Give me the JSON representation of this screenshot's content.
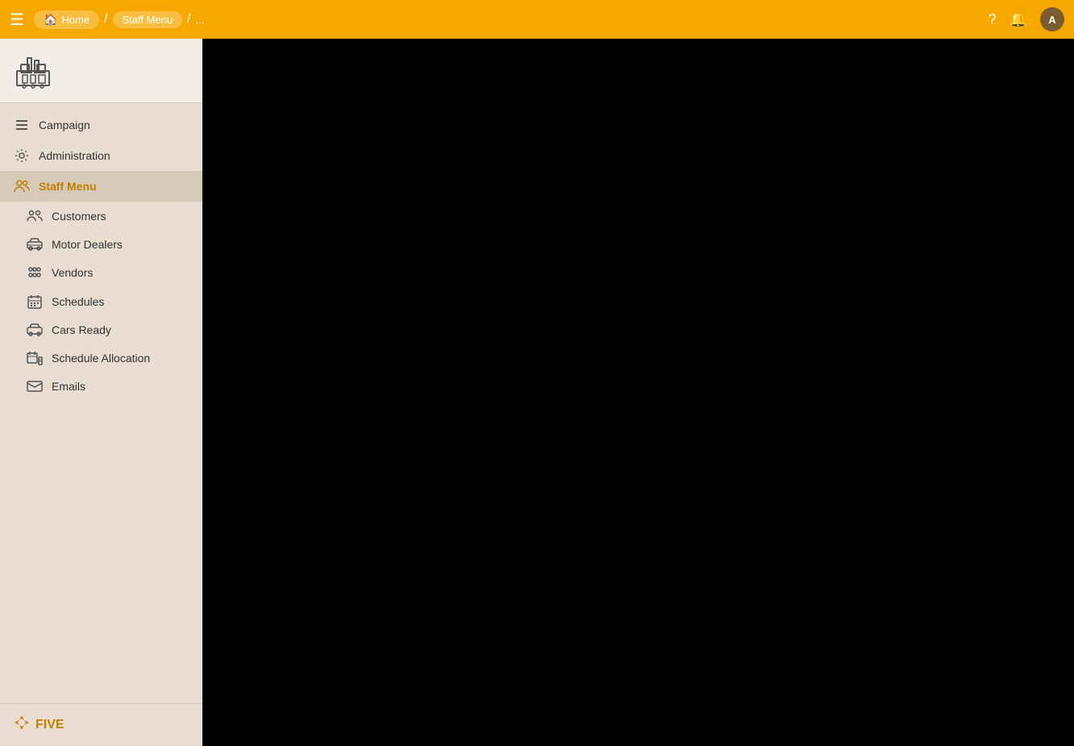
{
  "topbar": {
    "hamburger_label": "☰",
    "breadcrumbs": [
      {
        "id": "home",
        "label": "Home",
        "icon": "🏠"
      },
      {
        "id": "staff-menu",
        "label": "Staff Menu"
      }
    ],
    "dots_label": "...",
    "help_icon": "?",
    "notification_icon": "🔔",
    "avatar_label": "A"
  },
  "sidebar": {
    "logo_icon": "🏭",
    "nav_items": [
      {
        "id": "campaign",
        "label": "Campaign",
        "icon": "menu",
        "type": "top"
      },
      {
        "id": "administration",
        "label": "Administration",
        "icon": "gear",
        "type": "top"
      },
      {
        "id": "staff-menu",
        "label": "Staff Menu",
        "icon": "people",
        "type": "top",
        "active": true
      }
    ],
    "sub_items": [
      {
        "id": "customers",
        "label": "Customers",
        "icon": "customers"
      },
      {
        "id": "motor-dealers",
        "label": "Motor Dealers",
        "icon": "car"
      },
      {
        "id": "vendors",
        "label": "Vendors",
        "icon": "vendors"
      },
      {
        "id": "schedules",
        "label": "Schedules",
        "icon": "schedules"
      },
      {
        "id": "cars-ready",
        "label": "Cars Ready",
        "icon": "car2"
      },
      {
        "id": "schedule-allocation",
        "label": "Schedule Allocation",
        "icon": "schedule-alloc"
      },
      {
        "id": "emails",
        "label": "Emails",
        "icon": "email"
      }
    ],
    "footer": {
      "logo_label": "FIVE",
      "logo_icon": "✦"
    }
  }
}
